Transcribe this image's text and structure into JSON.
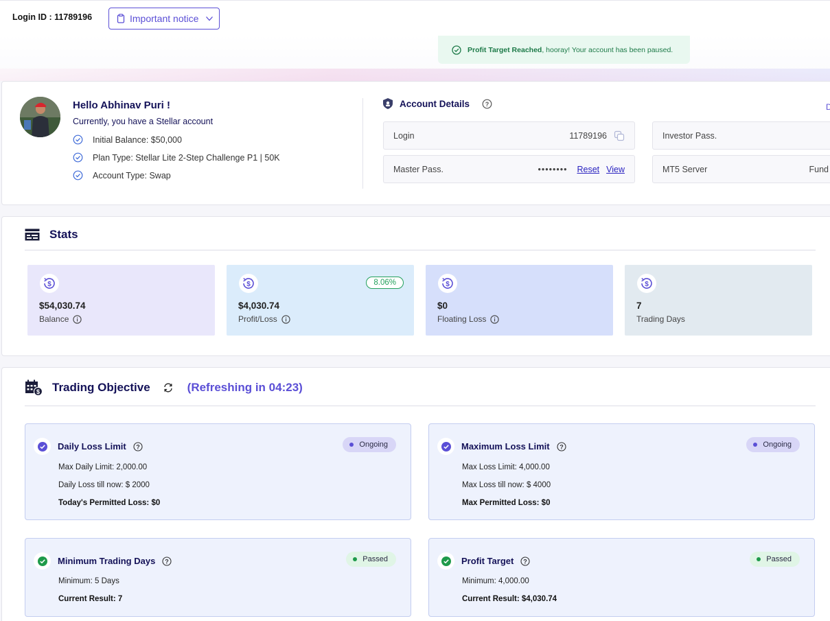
{
  "header": {
    "login_id": "Login ID : 11789196",
    "notice_label": "Important notice"
  },
  "toast": {
    "bold": "Profit Target Reached",
    "rest": ", hooray! Your account has been paused."
  },
  "profile": {
    "greeting": "Hello Abhinav Puri !",
    "account_line": "Currently, you have a Stellar account",
    "items": [
      "Initial Balance: $50,000",
      "Plan Type: Stellar Lite 2-Step Challenge P1 | 50K",
      "Account Type: Swap"
    ]
  },
  "account": {
    "title": "Account Details",
    "edge_text": "D",
    "login_label": "Login",
    "login_value": "11789196",
    "investor_label": "Investor Pass.",
    "master_label": "Master Pass.",
    "master_value": "••••••••",
    "reset_label": "Reset",
    "view_label": "View",
    "server_label": "MT5 Server",
    "server_value": "Fund"
  },
  "stats": {
    "title": "Stats",
    "items": [
      {
        "value": "$54,030.74",
        "label": "Balance",
        "bg": "#e9e7fb"
      },
      {
        "value": "$4,030.74",
        "label": "Profit/Loss",
        "bg": "#dbecfb",
        "badge": "8.06%"
      },
      {
        "value": "$0",
        "label": "Floating Loss",
        "bg": "#d6dffb"
      },
      {
        "value": "7",
        "label": "Trading Days",
        "bg": "#e2eaf0"
      }
    ]
  },
  "objectives": {
    "title": "Trading Objective",
    "refresh": "(Refreshing in 04:23)",
    "items": [
      {
        "title": "Daily Loss Limit",
        "status": "Ongoing",
        "lines": [
          "Max Daily Limit: 2,000.00",
          "Daily Loss till now: $ 2000",
          "Today's Permitted Loss: $0"
        ]
      },
      {
        "title": "Maximum Loss Limit",
        "status": "Ongoing",
        "lines": [
          "Max Loss Limit: 4,000.00",
          "Max Loss till now: $ 4000",
          "Max Permitted Loss: $0"
        ]
      },
      {
        "title": "Minimum Trading Days",
        "status": "Passed",
        "lines": [
          "Minimum: 5 Days",
          "Current Result: 7"
        ]
      },
      {
        "title": "Profit Target",
        "status": "Passed",
        "lines": [
          "Minimum: 4,000.00",
          "Current Result: $4,030.74"
        ]
      }
    ]
  },
  "colors": {
    "accent": "#5b4fd6",
    "navy": "#141258",
    "success": "#1e9a4a"
  }
}
